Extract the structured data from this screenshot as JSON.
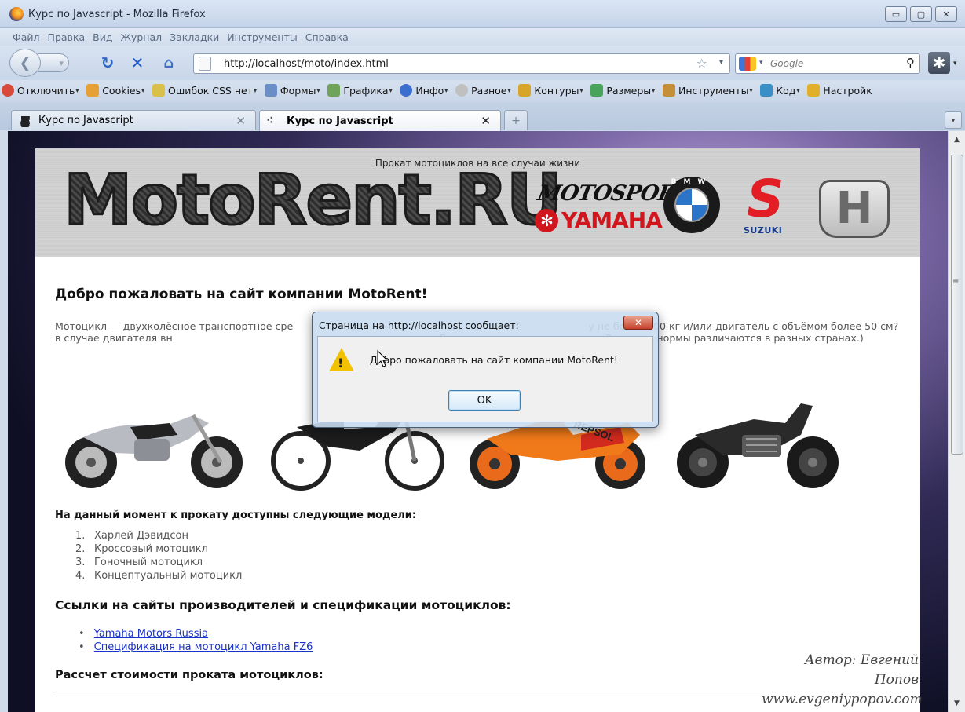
{
  "window": {
    "title": "Курс по Javascript - Mozilla Firefox",
    "controls": [
      "▭",
      "▢",
      "✕"
    ]
  },
  "menu": [
    "Файл",
    "Правка",
    "Вид",
    "Журнал",
    "Закладки",
    "Инструменты",
    "Справка"
  ],
  "navigation": {
    "url": "http://localhost/moto/index.html",
    "search_placeholder": "Google"
  },
  "toolbar": [
    {
      "label": "Отключить",
      "color": "#d84a3a"
    },
    {
      "label": "Cookies",
      "color": "#e7a035"
    },
    {
      "label": "Ошибок CSS нет",
      "color": "#d8c04a"
    },
    {
      "label": "Формы",
      "color": "#6a8fc7"
    },
    {
      "label": "Графика",
      "color": "#6fa35a"
    },
    {
      "label": "Инфо",
      "color": "#3a6fd0"
    },
    {
      "label": "Разное",
      "color": "#c0c0c0"
    },
    {
      "label": "Контуры",
      "color": "#d7a52a"
    },
    {
      "label": "Размеры",
      "color": "#4aa35a"
    },
    {
      "label": "Инструменты",
      "color": "#c58f3a"
    },
    {
      "label": "Код",
      "color": "#3a8fc7"
    },
    {
      "label": "Настройк",
      "color": "#e0b02a"
    }
  ],
  "tabs": [
    {
      "label": "Курс по Javascript",
      "active": false
    },
    {
      "label": "Курс по Javascript",
      "active": true
    }
  ],
  "header": {
    "slogan": "Прокат мотоциклов на все случаи жизни",
    "logo": "MotoRent.RU",
    "brands": {
      "motosport": "MOTOSPORT",
      "yamaha": "YAMAHA",
      "bmw": "BMW",
      "suzuki": "SUZUKI",
      "honda": "H"
    }
  },
  "main": {
    "welcome_heading": "Добро пожаловать на сайт компании MotoRent!",
    "intro": "Мотоцикл — двухколёсное транспортное сре                                                                                              у не более 400 кг и/или двигатель с объёмом более 50 см? в случае двигателя вн                                                                                   кВт в случае электродвигателя. Впрочем, нормы различаются в разных странах.)",
    "models_heading": "На данный момент к прокату доступны следующие модели:",
    "models": [
      "Харлей Дэвидсон",
      "Кроссовый мотоцикл",
      "Гоночный мотоцикл",
      "Концептуальный мотоцикл"
    ],
    "links_heading": "Ссылки на сайты производителей и спецификации мотоциклов:",
    "links": [
      "Yamaha Motors Russia",
      "Спецификация на мотоцикл Yamaha FZ6"
    ],
    "calc_heading": "Рассчет стоимости проката мотоциклов:",
    "author_line1": "Автор: Евгений Попов",
    "author_line2": "www.evgeniypopov.com"
  },
  "dialog": {
    "title": "Страница на http://localhost сообщает:",
    "message": "Добро пожаловать на сайт компании MotoRent!",
    "ok_label": "OK"
  }
}
